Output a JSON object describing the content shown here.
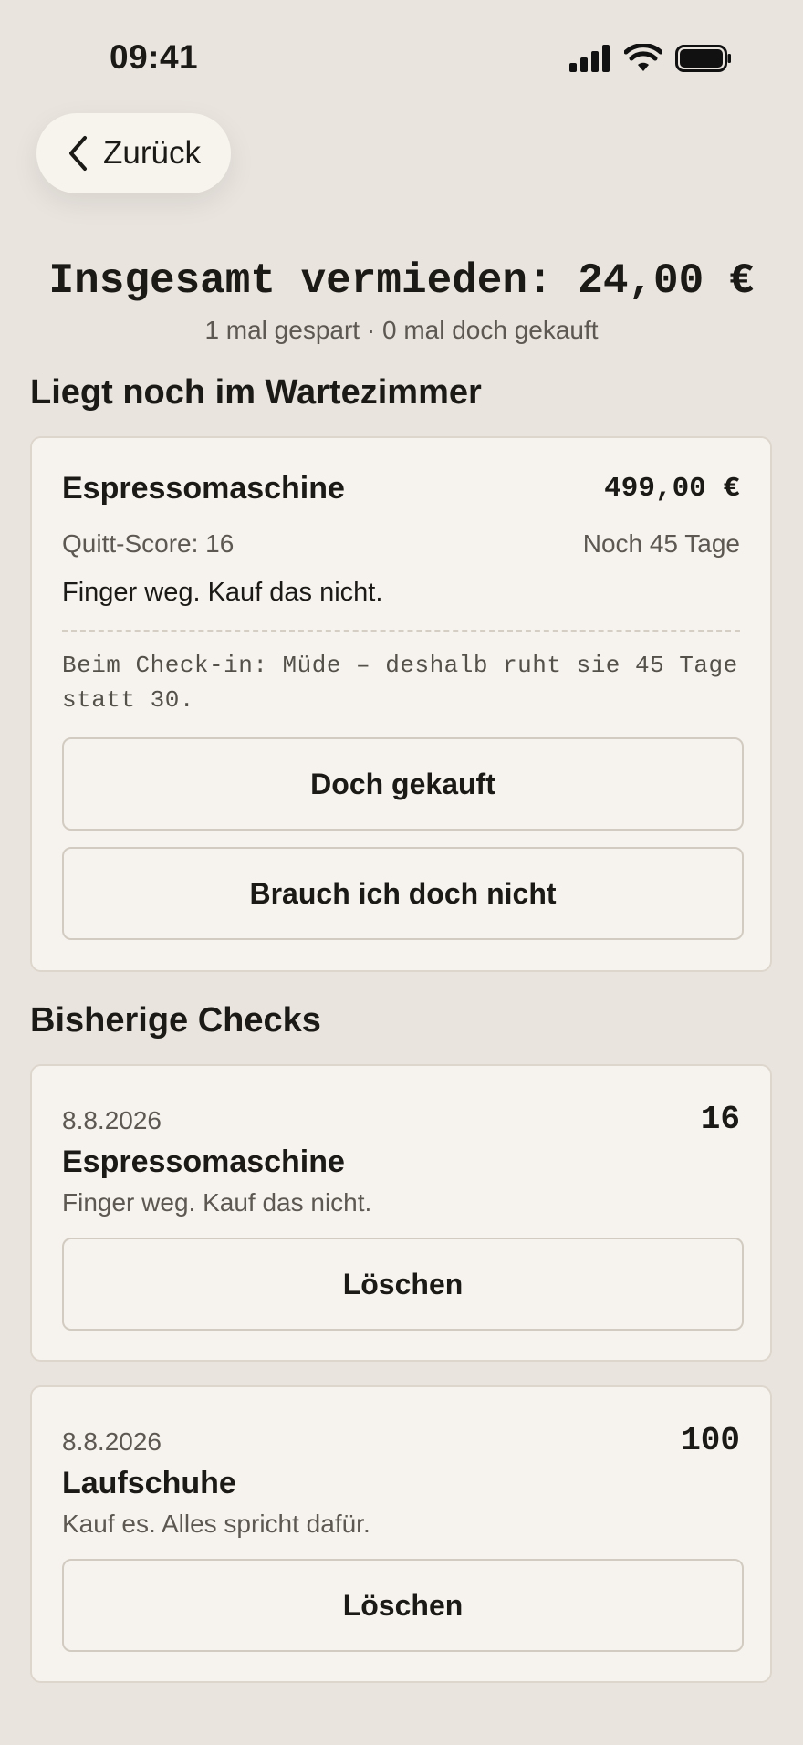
{
  "status": {
    "time": "09:41"
  },
  "nav": {
    "back_label": "Zurück"
  },
  "summary": {
    "total": "Insgesamt vermieden: 24,00 €",
    "stats": "1 mal gespart · 0 mal doch gekauft"
  },
  "waiting": {
    "title": "Liegt noch im Wartezimmer",
    "item": {
      "name": "Espressomaschine",
      "price": "499,00 €",
      "score": "Quitt-Score: 16",
      "remaining": "Noch 45 Tage",
      "verdict": "Finger weg. Kauf das nicht.",
      "note": "Beim Check-in: Müde – deshalb ruht sie 45 Tage statt 30.",
      "bought_label": "Doch gekauft",
      "skip_label": "Brauch ich doch nicht"
    }
  },
  "history": {
    "title": "Bisherige Checks",
    "items": [
      {
        "date": "8.8.2026",
        "score": "16",
        "name": "Espressomaschine",
        "verdict": "Finger weg. Kauf das nicht.",
        "delete_label": "Löschen"
      },
      {
        "date": "8.8.2026",
        "score": "100",
        "name": "Laufschuhe",
        "verdict": "Kauf es. Alles spricht dafür.",
        "delete_label": "Löschen"
      }
    ]
  },
  "icons": [
    "cellular-signal-icon",
    "wifi-icon",
    "battery-icon",
    "chevron-left-icon"
  ]
}
